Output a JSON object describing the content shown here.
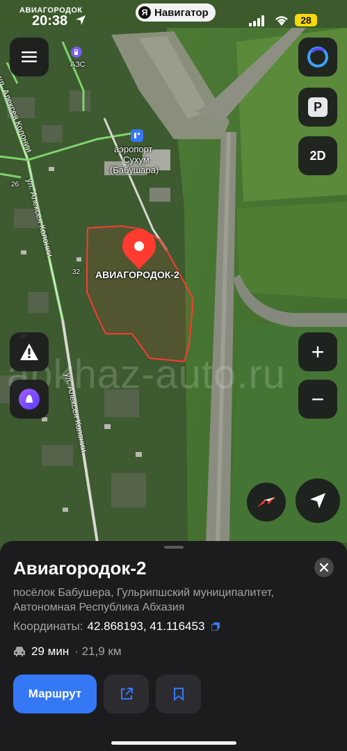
{
  "status_bar": {
    "location_label": "АВИАГОРОДОК",
    "time": "20:38",
    "app_pill": "Навигатор",
    "battery": "28"
  },
  "map": {
    "poi_gas_label": "АЗС",
    "poi_airport_label": [
      "аэропорт",
      "Сухум",
      "(Бабушара)"
    ],
    "selected_place_label": "АВИАГОРОДОК-2",
    "street_labels": [
      "ул. Алексея Колонии",
      "ул. Алексея Колонии",
      "ул. Алексея Колонии"
    ],
    "house_numbers": [
      "26",
      "32"
    ],
    "watermark": "apkhaz-auto.ru"
  },
  "controls": {
    "parking_label": "P",
    "view_mode_label": "2D",
    "zoom_in": "+",
    "zoom_out": "−"
  },
  "sheet": {
    "title": "Авиагородок-2",
    "address": "посёлок Бабушера, Гульрипшский муниципалитет, Автономная Республика Абхазия",
    "coords_label": "Координаты:",
    "coords_value": "42.868193, 41.116453",
    "eta_time": "29 мин",
    "eta_distance": "· 21,9 км",
    "route_button": "Маршрут"
  },
  "colors": {
    "accent_blue": "#3478f6",
    "pin_red": "#ff3b30",
    "sheet_bg": "#1c1c1e"
  }
}
